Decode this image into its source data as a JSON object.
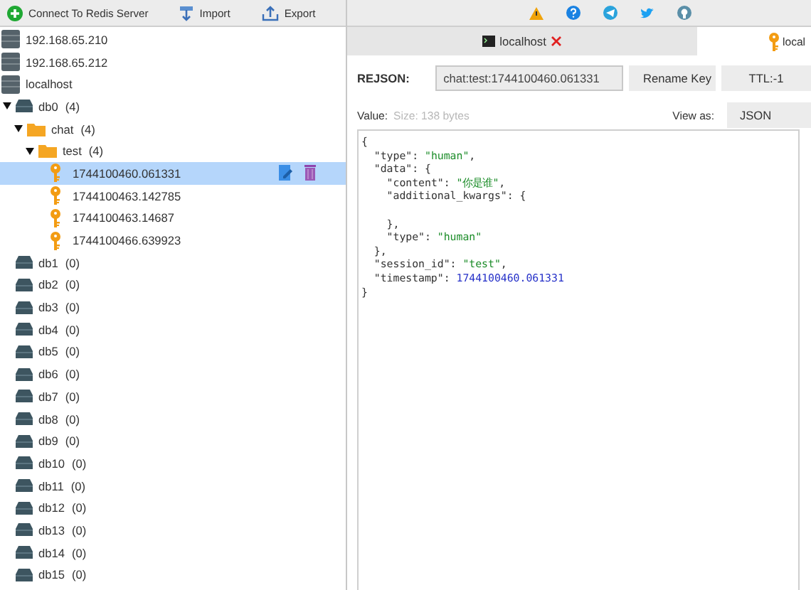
{
  "toolbar": {
    "buttons": [
      {
        "kind": "connect",
        "label": "Connect To Redis Server"
      },
      {
        "kind": "import",
        "label": "Import"
      },
      {
        "kind": "export",
        "label": "Export"
      }
    ]
  },
  "tree": [
    {
      "kind": "server",
      "label": "192.168.65.210"
    },
    {
      "kind": "server",
      "label": "192.168.65.212"
    },
    {
      "kind": "server",
      "label": "localhost",
      "children": [
        {
          "kind": "db",
          "label": "db0",
          "count": "(4)",
          "children": [
            {
              "kind": "folder",
              "label": "chat",
              "count": "(4)",
              "children": [
                {
                  "kind": "folder",
                  "label": "test",
                  "count": "(4)",
                  "children": [
                    {
                      "kind": "key",
                      "label": "1744100460.061331",
                      "selected": true
                    },
                    {
                      "kind": "key",
                      "label": "1744100463.142785",
                      "selected": false
                    },
                    {
                      "kind": "key",
                      "label": "1744100463.14687",
                      "selected": false
                    },
                    {
                      "kind": "key",
                      "label": "1744100466.639923",
                      "selected": false
                    }
                  ]
                }
              ]
            }
          ]
        },
        {
          "kind": "db",
          "label": "db1",
          "count": "(0)"
        },
        {
          "kind": "db",
          "label": "db2",
          "count": "(0)"
        },
        {
          "kind": "db",
          "label": "db3",
          "count": "(0)"
        },
        {
          "kind": "db",
          "label": "db4",
          "count": "(0)"
        },
        {
          "kind": "db",
          "label": "db5",
          "count": "(0)"
        },
        {
          "kind": "db",
          "label": "db6",
          "count": "(0)"
        },
        {
          "kind": "db",
          "label": "db7",
          "count": "(0)"
        },
        {
          "kind": "db",
          "label": "db8",
          "count": "(0)"
        },
        {
          "kind": "db",
          "label": "db9",
          "count": "(0)"
        },
        {
          "kind": "db",
          "label": "db10",
          "count": "(0)"
        },
        {
          "kind": "db",
          "label": "db11",
          "count": "(0)"
        },
        {
          "kind": "db",
          "label": "db12",
          "count": "(0)"
        },
        {
          "kind": "db",
          "label": "db13",
          "count": "(0)"
        },
        {
          "kind": "db",
          "label": "db14",
          "count": "(0)"
        },
        {
          "kind": "db",
          "label": "db15",
          "count": "(0)"
        }
      ]
    }
  ],
  "tabs": [
    {
      "kind": "console",
      "label": "localhost",
      "selected": false,
      "closable": true
    },
    {
      "kind": "key",
      "label": "local",
      "selected": true,
      "closable": false
    }
  ],
  "key_bar": {
    "type_label": "REJSON:",
    "key_name": "chat:test:1744100460.061331",
    "buttons": [
      "Rename Key",
      "TTL:-1"
    ]
  },
  "value_bar": {
    "label": "Value:",
    "size": "Size: 138 bytes",
    "view_as_label": "View as:",
    "view_as": "JSON"
  },
  "editor": {
    "lines": [
      [
        {
          "kind": "punct",
          "text": "{"
        }
      ],
      [
        {
          "kind": "key",
          "text": "\"type\""
        },
        {
          "kind": "punct",
          "text": ": "
        },
        {
          "kind": "string",
          "text": "\"human\""
        },
        {
          "kind": "punct",
          "text": ","
        }
      ],
      [
        {
          "kind": "key",
          "text": "\"data\""
        },
        {
          "kind": "punct",
          "text": ": {"
        }
      ],
      [
        {
          "kind": "key",
          "text": "\"content\""
        },
        {
          "kind": "punct",
          "text": ": "
        },
        {
          "kind": "string",
          "text": "\"你是谁\""
        },
        {
          "kind": "punct",
          "text": ","
        }
      ],
      [
        {
          "kind": "key",
          "text": "\"additional_kwargs\""
        },
        {
          "kind": "punct",
          "text": ": {"
        }
      ],
      [
        {
          "kind": "punct",
          "text": "},"
        }
      ],
      [
        {
          "kind": "key",
          "text": "\"type\""
        },
        {
          "kind": "punct",
          "text": ": "
        },
        {
          "kind": "string",
          "text": "\"human\""
        }
      ],
      [
        {
          "kind": "punct",
          "text": "},"
        }
      ],
      [
        {
          "kind": "key",
          "text": "\"session_id\""
        },
        {
          "kind": "punct",
          "text": ": "
        },
        {
          "kind": "string",
          "text": "\"test\""
        },
        {
          "kind": "punct",
          "text": ","
        }
      ],
      [
        {
          "kind": "key",
          "text": "\"timestamp\""
        },
        {
          "kind": "punct",
          "text": ": "
        },
        {
          "kind": "number",
          "text": "1744100460.061331"
        }
      ],
      [
        {
          "kind": "punct",
          "text": "}"
        }
      ]
    ]
  }
}
